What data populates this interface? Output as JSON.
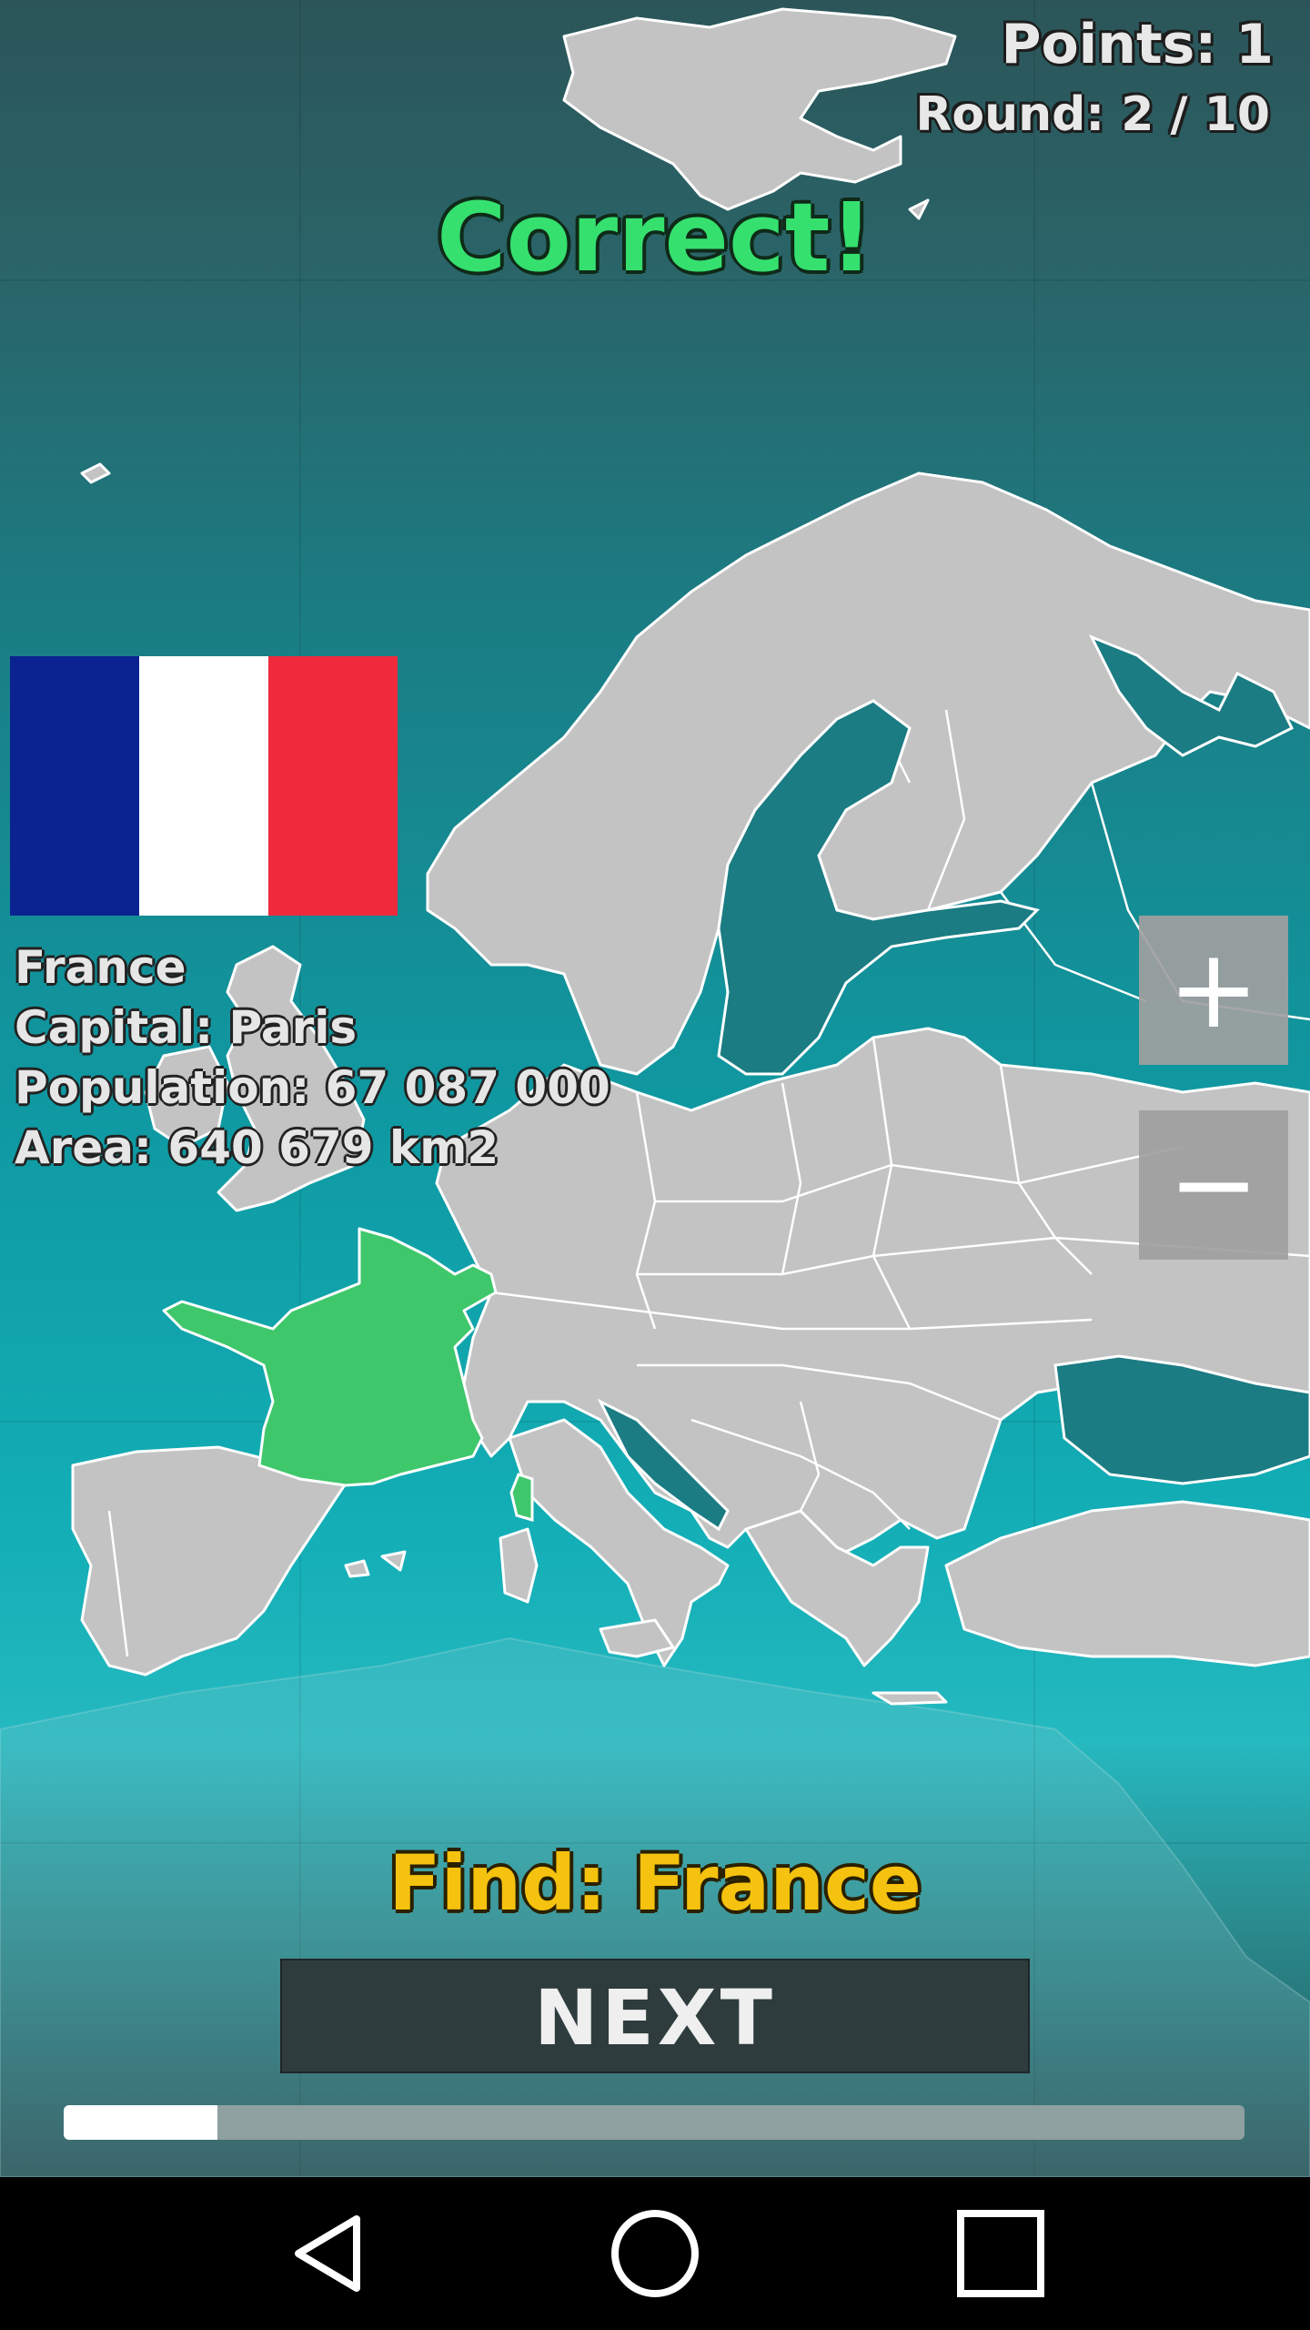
{
  "hud": {
    "points": "Points: 1",
    "round": "Round: 2 / 10"
  },
  "result": {
    "text": "Correct!",
    "color": "#35e06f"
  },
  "country": {
    "name": "France",
    "capital": "Capital: Paris",
    "population": "Population: 67 087 000",
    "area": "Area: 640 679 km2",
    "flag_colors": [
      "#0a2390",
      "#ffffff",
      "#ef2a3c"
    ],
    "highlight_color": "#3fc76b"
  },
  "zoom": {
    "in_label": "+",
    "out_label": "−"
  },
  "prompt": {
    "find": "Find: France",
    "color": "#f4c20f"
  },
  "controls": {
    "next_label": "NEXT"
  },
  "progress": {
    "fraction": 0.13
  },
  "navbar": {
    "icons": [
      "back-icon",
      "home-icon",
      "recents-icon"
    ]
  }
}
